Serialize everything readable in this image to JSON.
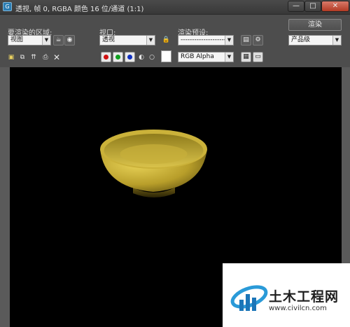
{
  "window": {
    "title": "透视, 帧 0, RGBA 颜色 16 位/通道 (1:1)",
    "minimize": "—",
    "maximize": "□",
    "close": "✕"
  },
  "controls": {
    "area_label": "要渲染的区域:",
    "area_value": "视图",
    "viewport_label": "视口:",
    "viewport_value": "透视",
    "preset_label": "渲染预设:",
    "preset_value": "-----------------------",
    "render_button": "渲染",
    "quality_value": "产品级"
  },
  "toolbar": {
    "channel_value": "RGB Alpha"
  },
  "colors": {
    "red_channel": "#d01010",
    "green_channel": "#10a020",
    "blue_channel": "#1030c0",
    "bowl": "#c9b53a"
  },
  "icons": [
    "app-icon",
    "teapot-icon",
    "region-icon",
    "lock-icon",
    "preset-save-icon",
    "preset-settings-icon",
    "save-image-icon",
    "copy-image-icon",
    "clone-window-icon",
    "print-icon",
    "clear-icon",
    "mono-toggle-icon",
    "display-toggle-icon",
    "frame-buffer-icon"
  ],
  "watermark": {
    "text": "土木工程网",
    "url": "www.civilcn.com"
  }
}
